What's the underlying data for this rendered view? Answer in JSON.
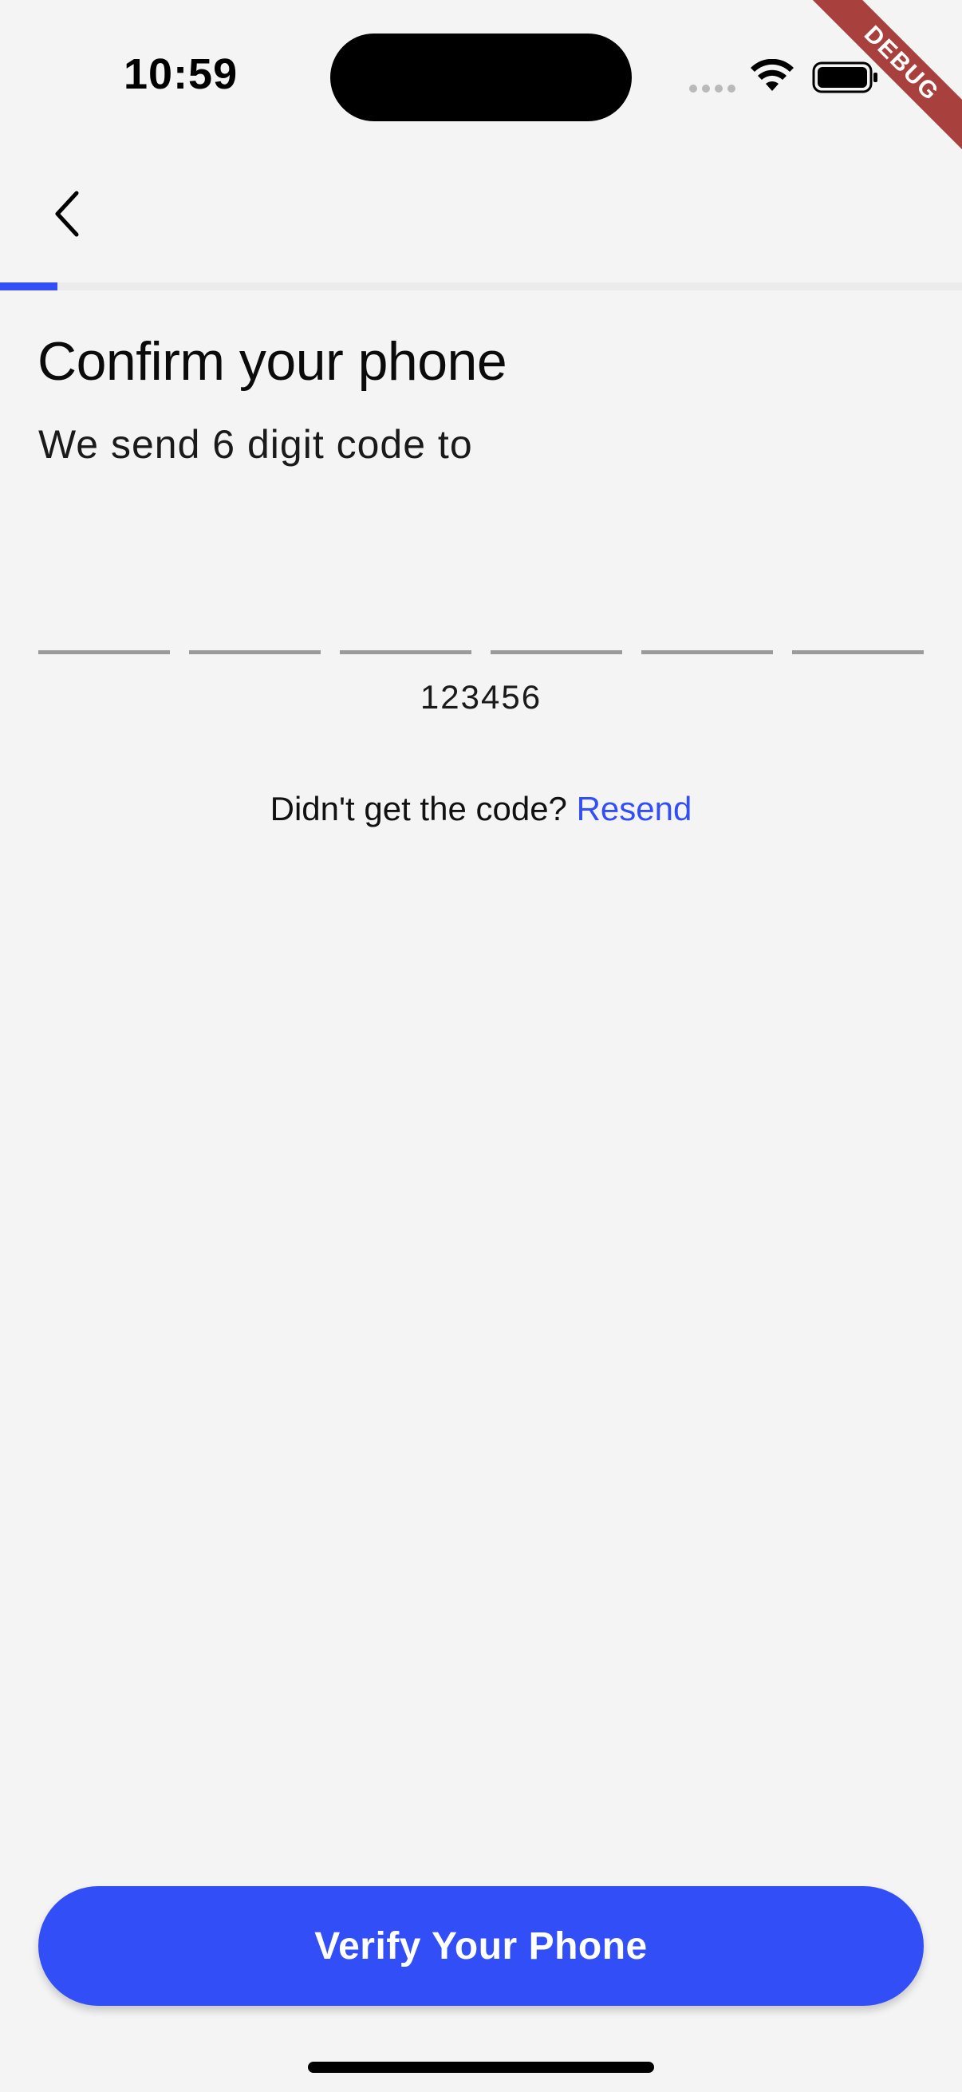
{
  "status_bar": {
    "time": "10:59",
    "icons": [
      "signal-dots-icon",
      "wifi-icon",
      "battery-icon"
    ]
  },
  "debug_banner": "DEBUG",
  "app_bar": {
    "back_icon": "chevron-left-icon",
    "progress_fraction": 0.06
  },
  "content": {
    "title": "Confirm your phone",
    "subtitle": "We send 6 digit code to",
    "otp_length": 6,
    "otp_value": "123456",
    "resend_prompt": "Didn't get the code?",
    "resend_link": "Resend"
  },
  "footer": {
    "verify_label": "Verify Your Phone"
  },
  "colors": {
    "accent": "#324ef6",
    "background": "#f4f4f5",
    "debug_ribbon": "#a8403d"
  }
}
